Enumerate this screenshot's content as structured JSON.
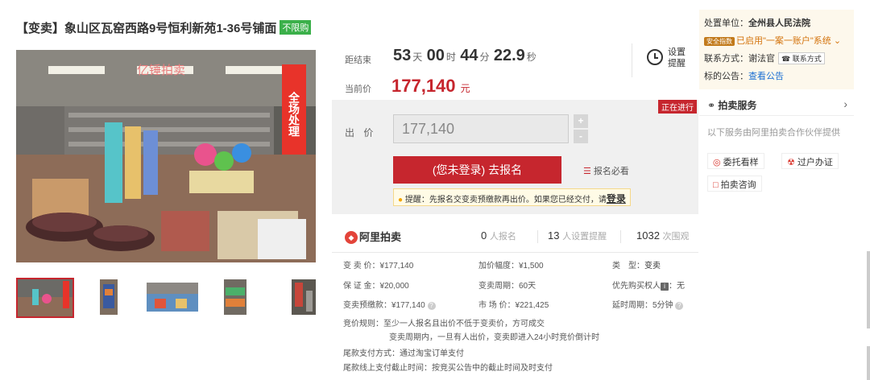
{
  "title": {
    "text": "【变卖】象山区瓦窑西路9号恒利新苑1-36号铺面",
    "tag": "不限购"
  },
  "image": {
    "watermark": "亿锤拍卖",
    "banner": "全场处理"
  },
  "countdown": {
    "label": "距结束",
    "days": "53",
    "days_unit": "天",
    "hours": "00",
    "hours_unit": "时",
    "minutes": "44",
    "minutes_unit": "分",
    "seconds": "22.9",
    "seconds_unit": "秒"
  },
  "reminder": {
    "line1": "设置",
    "line2": "提醒"
  },
  "current_price": {
    "label": "当前价",
    "value": "177,140",
    "unit": "元"
  },
  "status_badge": "正在进行",
  "bid": {
    "label": "出 价",
    "value": "177,140",
    "plus": "+",
    "minus": "-",
    "signup_button": "(您未登录) 去报名",
    "must_read": "报名必看",
    "tip_prefix": "提醒：先报名交变卖预缴款再出价。如果您已经交付，请",
    "tip_link": "登录"
  },
  "stats": {
    "brand": "阿里拍卖",
    "signups_count": "0",
    "signups_label": "人报名",
    "reminders_count": "13",
    "reminders_label": "人设置提醒",
    "views_count": "1032",
    "views_label": "次围观"
  },
  "info": {
    "sale_price": "变 卖 价：¥177,140",
    "increment": "加价幅度：¥1,500",
    "type_label": "类　型：",
    "type_value": "变卖",
    "deposit": "保 证 金：¥20,000",
    "period": "变卖周期：60天",
    "priority": "优先购买权人",
    "priority_value": "：无",
    "prepay": "变卖预缴款：¥177,140",
    "market": "市 场 价：¥221,425",
    "delay": "延时周期：5分钟",
    "rule_line1": "竞价规则：至少一人报名且出价不低于变卖价，方可成交",
    "rule_line2": "变卖周期内，一旦有人出价，变卖即进入24小时竞价倒计时",
    "payment": "尾款支付方式：通过淘宝订单支付",
    "deadline": "尾款线上支付截止时间：按竞买公告中的截止时间及时支付"
  },
  "right_panel": {
    "org_label": "处置单位：",
    "org_value": "全州县人民法院",
    "safe_badge": "安全指数",
    "account_text": "已启用\"一案一账户\"系统",
    "contact_label": "联系方式：谢法官",
    "contact_btn": "联系方式",
    "notice_label": "标的公告：",
    "notice_link": "查看公告",
    "service_title": "拍卖服务",
    "service_arrow": "›",
    "service_sub": "以下服务由阿里拍卖合作伙伴提供",
    "btn_viewing": "委托看样",
    "btn_transfer": "过户办证",
    "btn_consult": "拍卖咨询"
  }
}
